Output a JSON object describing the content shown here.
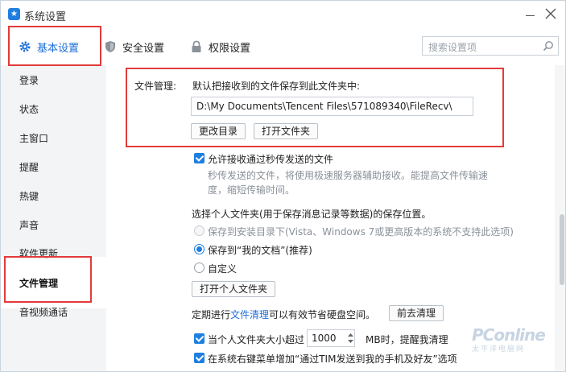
{
  "window": {
    "title": "系统设置"
  },
  "tabs": {
    "basic": "基本设置",
    "security": "安全设置",
    "permission": "权限设置"
  },
  "search": {
    "placeholder": "搜索设置项"
  },
  "sidebar": {
    "items": [
      {
        "label": "登录"
      },
      {
        "label": "状态"
      },
      {
        "label": "主窗口"
      },
      {
        "label": "提醒"
      },
      {
        "label": "热键"
      },
      {
        "label": "声音"
      },
      {
        "label": "软件更新"
      },
      {
        "label": "文件管理"
      },
      {
        "label": "音视频通话"
      }
    ],
    "active_index": 7
  },
  "file_mgmt": {
    "section_label": "文件管理:",
    "save_desc": "默认把接收到的文件保存到此文件夹中:",
    "path": "D:\\My Documents\\Tencent Files\\571089340\\FileRecv\\",
    "change_dir_btn": "更改目录",
    "open_folder_btn": "打开文件夹"
  },
  "fast_transfer": {
    "checked": true,
    "label": "允许接收通过秒传发送的文件",
    "desc_line1": "秒传发送的文件，将使用极速服务器辅助接收。能提高文件传输速",
    "desc_line2": "度，缩短传输时间。"
  },
  "personal_folder": {
    "heading": "选择个人文件夹(用于保存消息记录等数据)的保存位置。",
    "options": [
      {
        "label": "保存到安装目录下(Vista、Windows 7或更高版本的系统不支持此选项)",
        "state": "disabled"
      },
      {
        "label": "保存到“我的文档”(推荐)",
        "state": "selected"
      },
      {
        "label": "自定义",
        "state": "unselected"
      }
    ],
    "open_btn": "打开个人文件夹"
  },
  "cleanup": {
    "text_before": "定期进行",
    "link": "文件清理",
    "text_after": "可以有效节省硬盘空间。",
    "btn": "前去清理"
  },
  "size_remind": {
    "checked": true,
    "label_before": "当个人文件夹大小超过",
    "value": "1000",
    "label_after": "MB时，提醒我清理"
  },
  "context_menu": {
    "checked": true,
    "label": "在系统右键菜单增加“通过TIM发送到我的手机及好友”选项"
  },
  "watermark": {
    "logo": "PConline",
    "sub": "太平洋电脑网"
  },
  "colors": {
    "accent": "#1e6ed8",
    "highlight": "#e23b3b",
    "sidebar_bg": "#f2f4f6"
  }
}
